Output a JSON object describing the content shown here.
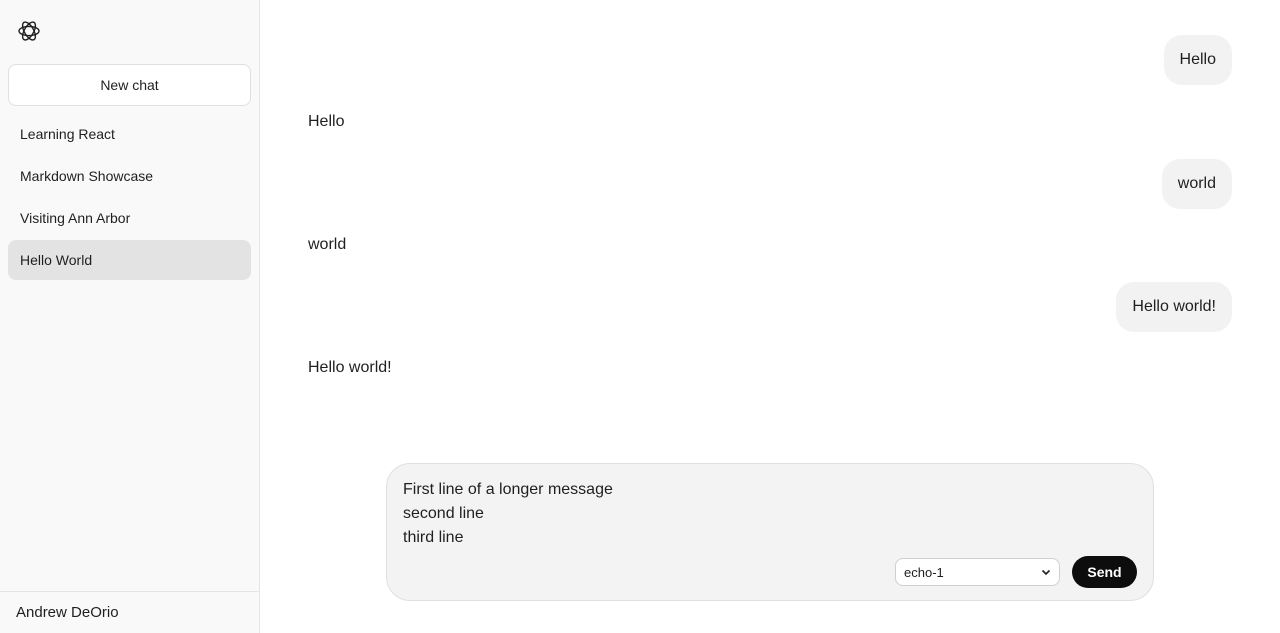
{
  "sidebar": {
    "new_chat_label": "New chat",
    "items": [
      {
        "label": "Learning React"
      },
      {
        "label": "Markdown Showcase"
      },
      {
        "label": "Visiting Ann Arbor"
      },
      {
        "label": "Hello World"
      }
    ],
    "user_name": "Andrew DeOrio"
  },
  "conversation": {
    "messages": [
      {
        "role": "user",
        "text": "Hello"
      },
      {
        "role": "assistant",
        "text": "Hello"
      },
      {
        "role": "user",
        "text": "world"
      },
      {
        "role": "assistant",
        "text": "world"
      },
      {
        "role": "user",
        "text": "Hello world!"
      },
      {
        "role": "assistant",
        "text": "Hello world!"
      }
    ]
  },
  "composer": {
    "value": "First line of a longer message\nsecond line\nthird line",
    "model_selected": "echo-1",
    "send_label": "Send"
  },
  "colors": {
    "accent": "#0d0d0d",
    "sidebar_bg": "#f9f9f9",
    "bubble_bg": "#f2f2f2",
    "active_item_bg": "#e3e3e3"
  },
  "icons": {
    "logo": "openai-logo-icon",
    "select_caret": "chevron-down-icon"
  }
}
